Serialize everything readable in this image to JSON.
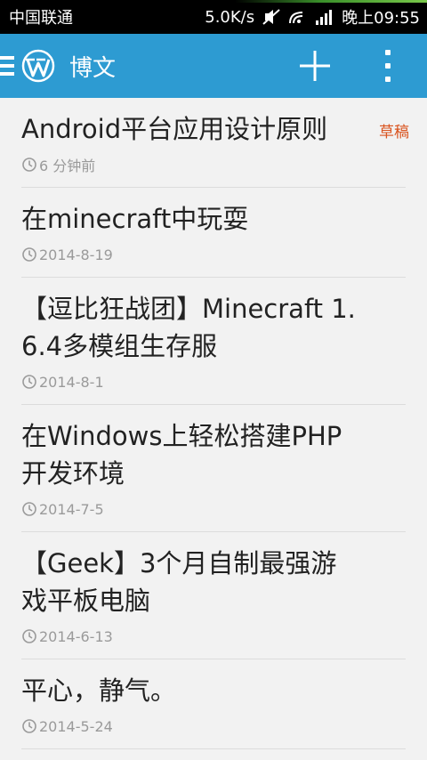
{
  "status_bar": {
    "carrier": "中国联通",
    "network_speed": "5.0K/s",
    "time": "晚上09:55"
  },
  "app_bar": {
    "title": "博文"
  },
  "posts": [
    {
      "title": "Android平台应用设计原则",
      "date": "6 分钟前",
      "badge": "草稿"
    },
    {
      "title": "在minecraft中玩耍",
      "date": "2014-8-19"
    },
    {
      "title": "【逗比狂战团】Minecraft 1.6.4多模组生存服",
      "date": "2014-8-1"
    },
    {
      "title": "在Windows上轻松搭建PHP开发环境",
      "date": "2014-7-5"
    },
    {
      "title": "【Geek】3个月自制最强游戏平板电脑",
      "date": "2014-6-13"
    },
    {
      "title": "平心，静气。",
      "date": "2014-5-24"
    }
  ],
  "colors": {
    "app_bar": "#2d9bd2",
    "draft": "#d9531e",
    "meta": "#9a9a9a"
  },
  "icons": {
    "nav": "menu-icon",
    "logo": "wordpress-logo-icon",
    "add": "add-icon",
    "overflow": "overflow-menu-icon",
    "clock": "clock-icon"
  }
}
